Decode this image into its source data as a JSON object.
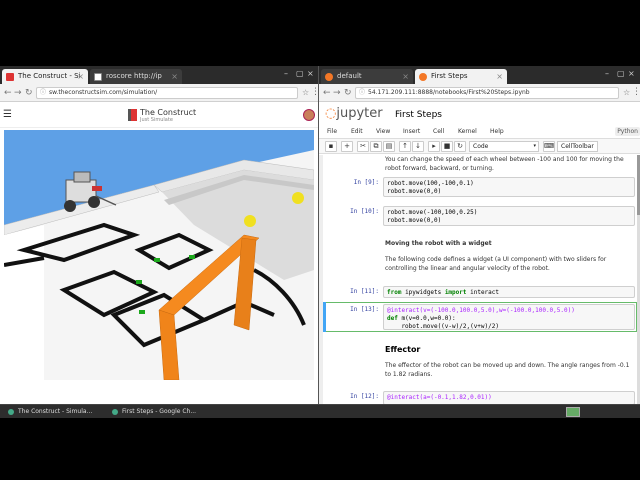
{
  "left_browser": {
    "tabs": [
      {
        "label": "The Construct - Si",
        "active": true
      },
      {
        "label": "roscore http://ip",
        "active": false
      }
    ],
    "url": "sw.theconstructsim.com/simulation/",
    "site_title": "The Construct",
    "site_subtitle": "Just Simulate"
  },
  "right_browser": {
    "tabs": [
      {
        "label": "default",
        "active": false
      },
      {
        "label": "First Steps",
        "active": true
      }
    ],
    "url": "54.171.209.111:8888/notebooks/First%20Steps.ipynb"
  },
  "jupyter": {
    "logo_text": "jupyter",
    "notebook_name": "First Steps",
    "menu": [
      "File",
      "Edit",
      "View",
      "Insert",
      "Cell",
      "Kernel",
      "Help"
    ],
    "kernel": "Python",
    "cell_type": "Code",
    "celltoolbar_label": "CellToolbar",
    "cells": {
      "intro_text": "You can change the speed of each wheel between -100 and 100 for moving the robot forward, backward, or turning.",
      "c9_prompt": "In [9]:",
      "c9_l1": "robot.move(100,-100,0.1)",
      "c9_l2": "robot.move(0,0)",
      "c10_prompt": "In [10]:",
      "c10_l1": "robot.move(-100,100,0.25)",
      "c10_l2": "robot.move(0,0)",
      "widget_heading": "Moving the robot with a widget",
      "widget_text": "The following code defines a widget (a UI component) with two sliders for controlling the linear and angular velocity of the robot.",
      "c11_prompt": "In [11]:",
      "c11_from": "from",
      "c11_mod": " ipywidgets ",
      "c11_import": "import",
      "c11_name": " interact",
      "c13_prompt": "In [13]:",
      "c13_l1": "@interact(v=(-100.0,100.0,5.0),w=(-100.0,100.0,5.0))",
      "c13_def": "def",
      "c13_l2": " m(v=0.0,w=0.0):",
      "c13_l3": "    robot.move((v-w)/2,(v+w)/2)",
      "effector_heading": "Effector",
      "effector_text": "The effector of the robot can be moved up and down. The angle ranges from -0.1 to 1.82 radians.",
      "c12_prompt": "In [12]:",
      "c12_l1": "@interact(a=(-0.1,1.82,0.01))"
    }
  },
  "taskbar": {
    "items": [
      {
        "label": "The Construct - Simula..."
      },
      {
        "label": "First Steps - Google Ch..."
      }
    ]
  },
  "colors": {
    "sky": "#5ea0e6",
    "floor": "#ffffff",
    "track": "#111111",
    "gate": "#f58a1f",
    "ball": "#f0e020",
    "jupyter_orange": "#f37726",
    "selected_cell": "#66bb6a"
  }
}
